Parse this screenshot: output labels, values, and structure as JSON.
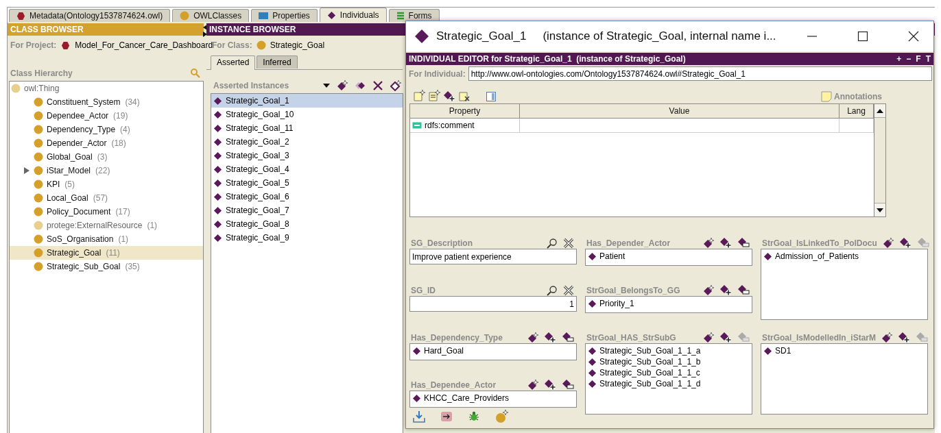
{
  "tabs": [
    {
      "label": "Metadata(Ontology1537874624.owl)",
      "kind": "metadata",
      "selected": false
    },
    {
      "label": "OWLClasses",
      "kind": "classes",
      "selected": false
    },
    {
      "label": "Properties",
      "kind": "properties",
      "selected": false
    },
    {
      "label": "Individuals",
      "kind": "individuals",
      "selected": true
    },
    {
      "label": "Forms",
      "kind": "forms",
      "selected": false
    }
  ],
  "class_browser": {
    "title": "CLASS BROWSER",
    "project_label": "For Project:",
    "project": "Model_For_Cancer_Care_Dashboard",
    "hierarchy_label": "Class Hierarchy",
    "tree": [
      {
        "name": "owl:Thing",
        "kind": "system",
        "collapsed": false,
        "selected": false,
        "children": [
          {
            "name": "Constituent_System",
            "count": "(34)",
            "kind": "class",
            "collapsed": false,
            "selected": false
          },
          {
            "name": "Dependee_Actor",
            "count": "(19)",
            "kind": "class",
            "collapsed": false,
            "selected": false
          },
          {
            "name": "Dependency_Type",
            "count": "(4)",
            "kind": "class",
            "collapsed": false,
            "selected": false
          },
          {
            "name": "Depender_Actor",
            "count": "(18)",
            "kind": "class",
            "collapsed": false,
            "selected": false
          },
          {
            "name": "Global_Goal",
            "count": "(3)",
            "kind": "class",
            "collapsed": false,
            "selected": false
          },
          {
            "name": "iStar_Model",
            "count": "(22)",
            "kind": "class",
            "collapsed": true,
            "selected": false
          },
          {
            "name": "KPI",
            "count": "(5)",
            "kind": "class",
            "collapsed": false,
            "selected": false
          },
          {
            "name": "Local_Goal",
            "count": "(57)",
            "kind": "class",
            "collapsed": false,
            "selected": false
          },
          {
            "name": "Policy_Document",
            "count": "(17)",
            "kind": "class",
            "collapsed": false,
            "selected": false
          },
          {
            "name": "protege:ExternalResource",
            "count": "(1)",
            "kind": "system",
            "collapsed": false,
            "selected": false
          },
          {
            "name": "SoS_Organisation",
            "count": "(1)",
            "kind": "class",
            "collapsed": false,
            "selected": false
          },
          {
            "name": "Strategic_Goal",
            "count": "(11)",
            "kind": "class",
            "collapsed": false,
            "selected": true
          },
          {
            "name": "Strategic_Sub_Goal",
            "count": "(35)",
            "kind": "class",
            "collapsed": false,
            "selected": false
          }
        ]
      }
    ]
  },
  "instance_browser": {
    "title": "INSTANCE BROWSER",
    "class_label": "For Class:",
    "class": "Strategic_Goal",
    "tabs": [
      {
        "label": "Asserted",
        "selected": true
      },
      {
        "label": "Inferred",
        "selected": false
      }
    ],
    "list_label": "Asserted Instances",
    "instances": [
      {
        "name": "Strategic_Goal_1",
        "selected": true
      },
      {
        "name": "Strategic_Goal_10",
        "selected": false
      },
      {
        "name": "Strategic_Goal_11",
        "selected": false
      },
      {
        "name": "Strategic_Goal_2",
        "selected": false
      },
      {
        "name": "Strategic_Goal_3",
        "selected": false
      },
      {
        "name": "Strategic_Goal_4",
        "selected": false
      },
      {
        "name": "Strategic_Goal_5",
        "selected": false
      },
      {
        "name": "Strategic_Goal_6",
        "selected": false
      },
      {
        "name": "Strategic_Goal_7",
        "selected": false
      },
      {
        "name": "Strategic_Goal_8",
        "selected": false
      },
      {
        "name": "Strategic_Goal_9",
        "selected": false
      }
    ]
  },
  "editor": {
    "title": "Strategic_Goal_1",
    "title_detail": "(instance of Strategic_Goal, internal name i...",
    "header": "INDIVIDUAL EDITOR for Strategic_Goal_1  (instance of Strategic_Goal)",
    "header_buttons": [
      "+",
      "−",
      "F",
      "T"
    ],
    "for_label": "For Individual:",
    "uri": "http://www.owl-ontologies.com/Ontology1537874624.owl#Strategic_Goal_1",
    "annotations_label": "Annotations",
    "table": {
      "columns": [
        "Property",
        "Value",
        "Lang"
      ],
      "rows": [
        {
          "property": "rdfs:comment"
        }
      ]
    },
    "widgets": [
      [
        {
          "kind": "text",
          "label": "SG_Description",
          "value": "Improve patient experience"
        },
        {
          "kind": "number",
          "label": "SG_ID",
          "value": "1"
        },
        {
          "kind": "instances",
          "label": "Has_Dependency_Type",
          "items": [
            "Hard_Goal"
          ],
          "remove_disabled": false
        },
        {
          "kind": "instances",
          "label": "Has_Dependee_Actor",
          "items": [
            "KHCC_Care_Providers"
          ],
          "remove_disabled": false
        }
      ],
      [
        {
          "kind": "instances",
          "label": "Has_Depender_Actor",
          "items": [
            "Patient"
          ],
          "remove_disabled": false
        },
        {
          "kind": "instances",
          "label": "StrGoal_BelongsTo_GG",
          "items": [
            "Priority_1"
          ],
          "remove_disabled": false
        },
        {
          "kind": "instance_list",
          "label": "StrGoal_HAS_StrSubG",
          "items": [
            "Strategic_Sub_Goal_1_1_a",
            "Strategic_Sub_Goal_1_1_b",
            "Strategic_Sub_Goal_1_1_c",
            "Strategic_Sub_Goal_1_1_d"
          ],
          "remove_disabled": true
        }
      ],
      [
        {
          "kind": "instance_list",
          "label": "StrGoal_IsLinkedTo_PolDocu",
          "items": [
            "Admission_of_Patients"
          ],
          "remove_disabled": true
        },
        {
          "kind": "instance_list",
          "label": "StrGoal_IsModelledIn_iStarM",
          "items": [
            "SD1"
          ],
          "remove_disabled": true
        }
      ]
    ]
  }
}
